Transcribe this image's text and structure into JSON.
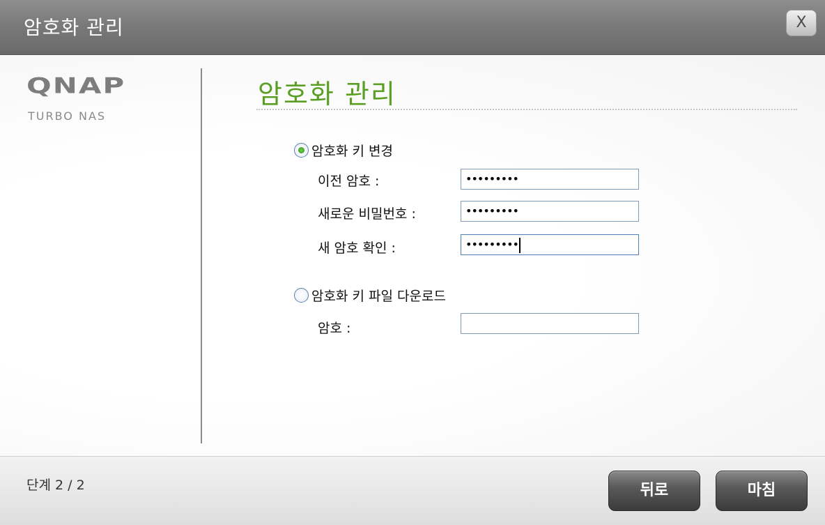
{
  "window": {
    "title": "암호화 관리",
    "close_label": "X"
  },
  "logo": {
    "main": "QNAP",
    "sub": "TURBO NAS"
  },
  "main": {
    "heading": "암호화 관리",
    "options": [
      {
        "label": "암호화 키 변경",
        "selected": true,
        "fields": [
          {
            "label": "이전 암호 :",
            "value": "•••••••••"
          },
          {
            "label": "새로운 비밀번호 :",
            "value": "•••••••••"
          },
          {
            "label": "새 암호 확인 :",
            "value": "•••••••••"
          }
        ]
      },
      {
        "label": "암호화 키 파일 다운로드",
        "selected": false,
        "fields": [
          {
            "label": "암호 :",
            "value": ""
          }
        ]
      }
    ]
  },
  "footer": {
    "step": "단계 2 / 2",
    "back_label": "뒤로",
    "finish_label": "마침"
  }
}
